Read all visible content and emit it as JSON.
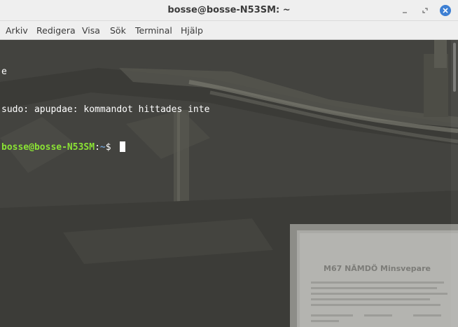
{
  "window": {
    "title": "bosse@bosse-N53SM: ~",
    "controls": [
      "minimize-icon",
      "maximize-icon",
      "close-icon"
    ],
    "close_color": "#3d7fd3"
  },
  "menubar": {
    "items": [
      "Arkiv",
      "Redigera",
      "Visa",
      "Sök",
      "Terminal",
      "Hjälp"
    ]
  },
  "terminal": {
    "lines": [
      "e",
      "sudo: apupdae: kommandot hittades inte"
    ],
    "prompt": {
      "user_host": "bosse@bosse-N53SM",
      "separator": ":",
      "path": "~",
      "symbol": "$ "
    },
    "colors": {
      "text": "#ffffff",
      "user_host": "#8ae234",
      "path": "#729fcf"
    }
  },
  "background_image": {
    "plaque_title": "M67 NÄMDÖ Minsvepare"
  }
}
